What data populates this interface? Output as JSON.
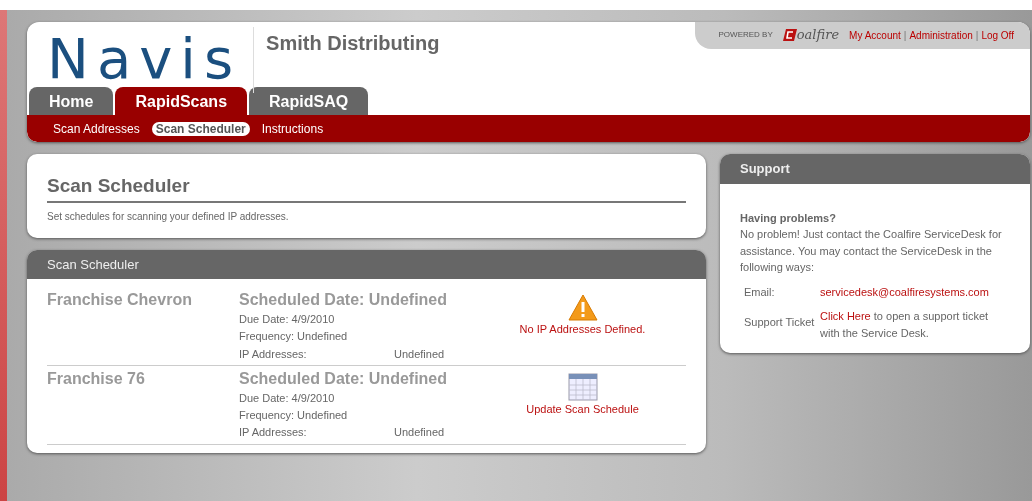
{
  "header": {
    "logo": "Navis",
    "company": "Smith Distributing",
    "powered_by": "POWERED BY",
    "powered_logo": "oalfire",
    "links": [
      "My Account",
      "Administration",
      "Log Off"
    ],
    "separators": [
      "|",
      "|"
    ]
  },
  "tabs": [
    {
      "label": "Home",
      "selected": false
    },
    {
      "label": "RapidScans",
      "selected": true
    },
    {
      "label": "RapidSAQ",
      "selected": false
    }
  ],
  "subnav": [
    {
      "label": "Scan Addresses",
      "selected": false
    },
    {
      "label": "Scan Scheduler",
      "selected": true
    },
    {
      "label": "Instructions",
      "selected": false
    }
  ],
  "intro": {
    "title": "Scan Scheduler",
    "text": "Set schedules for scanning your defined IP addresses."
  },
  "scheduler": {
    "title": "Scan Scheduler",
    "rows": [
      {
        "name": "Franchise Chevron",
        "scheduled": "Scheduled Date: Undefined",
        "due": "Due Date: 4/9/2010",
        "frequency": "Frequency: Undefined",
        "ip_label": "IP Addresses:",
        "ip_value": "Undefined",
        "kind": "warning",
        "action": "No IP Addresses Defined."
      },
      {
        "name": "Franchise 76",
        "scheduled": "Scheduled Date: Undefined",
        "due": "Due Date: 4/9/2010",
        "frequency": "Frequency: Undefined",
        "ip_label": "IP Addresses:",
        "ip_value": "Undefined",
        "kind": "calendar",
        "action": "Update Scan Schedule"
      }
    ]
  },
  "support": {
    "title": "Support",
    "heading": "Having problems?",
    "text": "No problem! Just contact the Coalfire ServiceDesk for assistance. You may contact the ServiceDesk in the following ways:",
    "email_label": "Email:",
    "email": "servicedesk@coalfiresystems.com",
    "ticket_label": "Support Ticket",
    "ticket_link": "Click Here",
    "ticket_text": "to open a support ticket with the Service Desk."
  }
}
